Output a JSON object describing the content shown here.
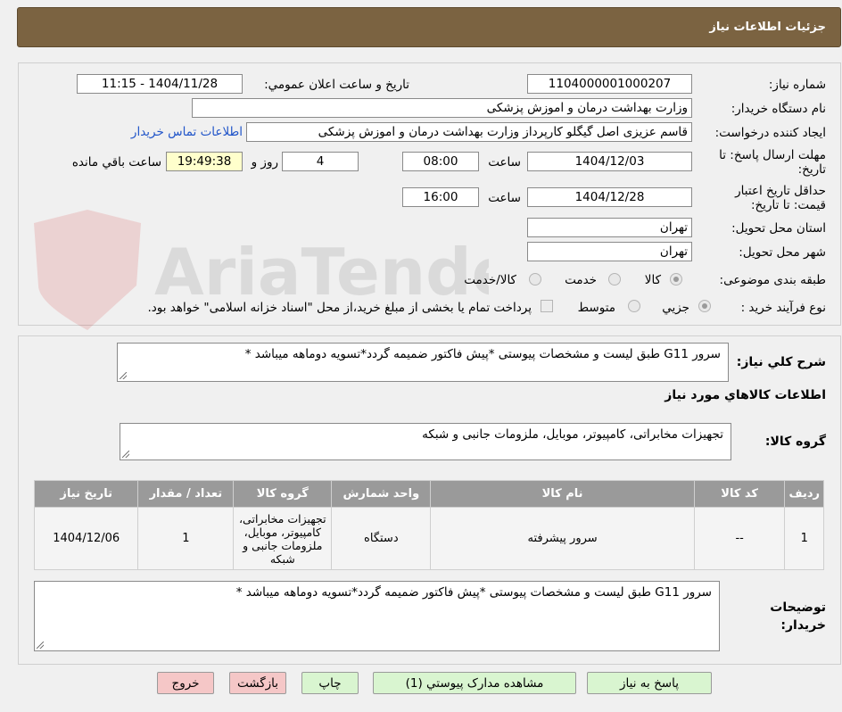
{
  "title": "جزئیات اطلاعات نیاز",
  "form": {
    "need_number_label": "شماره نیاز:",
    "need_number": "1104000001000207",
    "announce_label": "تاریخ و ساعت اعلان عمومي:",
    "announce_value": "1404/11/28 - 11:15",
    "buyer_org_label": "نام دستگاه خریدار:",
    "buyer_org": "وزارت بهداشت  درمان و اموزش پزشکی",
    "requester_label": "ایجاد کننده درخواست:",
    "requester": "قاسم عزیزی اصل گیگلو کارپرداز وزارت بهداشت  درمان و اموزش پزشکی",
    "contact_link": "اطلاعات تماس خریدار",
    "reply_deadline_label": "مهلت ارسال پاسخ: تا تاریخ:",
    "reply_date": "1404/12/03",
    "time_label": "ساعت",
    "reply_time": "08:00",
    "days_value": "4",
    "days_label": "روز و",
    "remaining_time": "19:49:38",
    "remaining_label": "ساعت باقي مانده",
    "price_valid_label": "حداقل تاریخ اعتبار قیمت: تا تاریخ:",
    "price_valid_date": "1404/12/28",
    "price_valid_time": "16:00",
    "province_label": "استان محل تحویل:",
    "province": "تهران",
    "city_label": "شهر محل تحویل:",
    "city": "تهران",
    "category_label": "طبقه بندی موضوعی:",
    "category_options": [
      "کالا",
      "خدمت",
      "کالا/خدمت"
    ],
    "process_label": "نوع فرآیند خرید :",
    "process_options": [
      "جزیي",
      "متوسط"
    ],
    "payment_note": "پرداخت تمام یا بخشی از مبلغ خرید،از محل \"اسناد خزانه اسلامی\" خواهد بود."
  },
  "summary": {
    "label": "شرح کلي نیاز:",
    "text": "سرور G11 طبق لیست و مشخصات پیوستی *پیش فاکتور ضمیمه گردد*تسویه دوماهه میباشد *"
  },
  "goods": {
    "section_title": "اطلاعات کالاهاي مورد نیاز",
    "group_label": "گروه کالا:",
    "group_value": "تجهیزات مخابراتی، کامپیوتر، موبایل، ملزومات جانبی و شبکه",
    "columns": [
      "ردیف",
      "کد کالا",
      "نام کالا",
      "واحد شمارش",
      "گروه کالا",
      "تعداد / مقدار",
      "تاریخ نیاز"
    ],
    "rows": [
      {
        "row": "1",
        "code": "--",
        "name": "سرور پیشرفته",
        "unit": "دستگاه",
        "group": "تجهیزات مخابراتی، کامپیوتر، موبایل، ملزومات جانبی و شبکه",
        "qty": "1",
        "date": "1404/12/06"
      }
    ]
  },
  "buyer_notes": {
    "label": "توضیحات خریدار:",
    "text": "سرور G11 طبق لیست و مشخصات پیوستی *پیش فاکتور ضمیمه گردد*تسویه دوماهه میباشد *"
  },
  "buttons": {
    "reply": "پاسخ به نیاز",
    "attachments": "مشاهده مدارک پیوستي (1)",
    "print": "چاپ",
    "back": "بازگشت",
    "exit": "خروج"
  },
  "watermark_text": "AriaTender.neT"
}
